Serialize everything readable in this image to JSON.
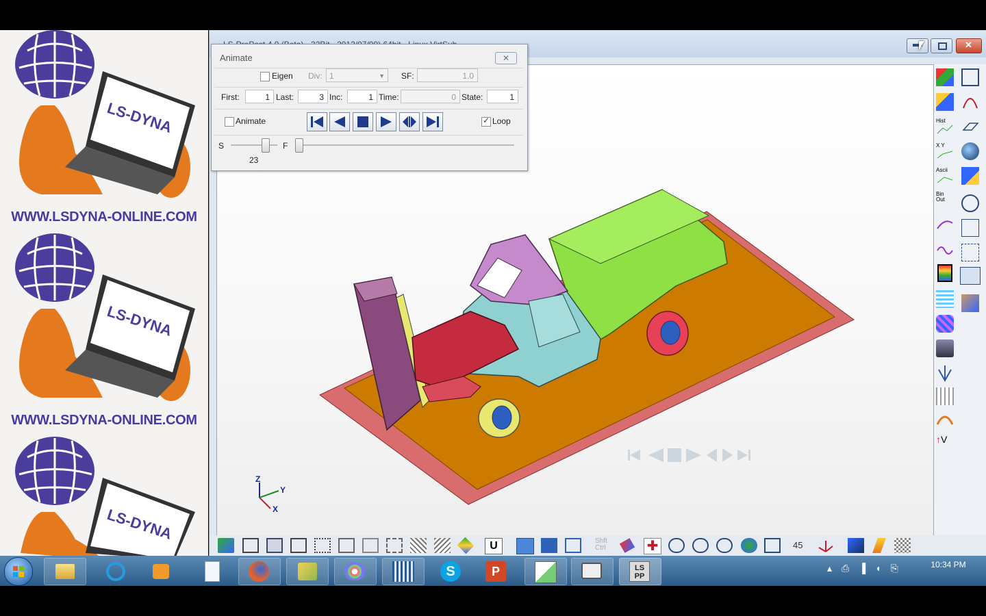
{
  "promo": {
    "laptop_text": "LS-DYNA",
    "url": "WWW.LSDYNA-ONLINE.COM"
  },
  "window": {
    "title": "LS-PrePost 4.0 (Beta) - 32Bit - 2012/07/09) 64bit - Linux VirtSub",
    "minimize_label": "▬",
    "maximize_label": "▢",
    "close_label": "✕"
  },
  "animate": {
    "title": "Animate",
    "close_label": "✕",
    "eigen_label": "Eigen",
    "div_label": "Div:",
    "div_value": "1",
    "sf_label": "SF:",
    "sf_value": "1.0",
    "first_label": "First:",
    "first_value": "1",
    "last_label": "Last:",
    "last_value": "3",
    "inc_label": "Inc:",
    "inc_value": "1",
    "time_label": "Time:",
    "time_value": "0",
    "state_label": "State:",
    "state_value": "1",
    "animate_label": "Animate",
    "loop_label": "Loop",
    "loop_checked": true,
    "s_label": "S",
    "f_label": "F",
    "speed_value": "23",
    "speed_fraction": 0.73,
    "frame_fraction": 0.0
  },
  "axis": {
    "z": "Z",
    "y": "Y",
    "x": "X"
  },
  "rightbar": {
    "hist": "Hist",
    "xy": "X Y",
    "ascii": "Ascii",
    "binout": "Bin Out",
    "v": "V"
  },
  "bottombar": {
    "u_label": "U",
    "shift_label": "Shft Ctrl",
    "angle_value": "45"
  },
  "taskbar": {
    "lspp_label": "LS PP",
    "clock": "10:34 PM"
  },
  "colors": {
    "floor": "#cc7a00",
    "floor_border": "#d96d6d",
    "cab_body": "#8fd0d0",
    "hood": "#c52b3e",
    "bed": "#8ee044",
    "roof": "#c58acb",
    "barrier": "#8a4a7e",
    "tire": "#e8e870",
    "rear_tire": "#e84057",
    "rim": "#2d5fbf"
  }
}
